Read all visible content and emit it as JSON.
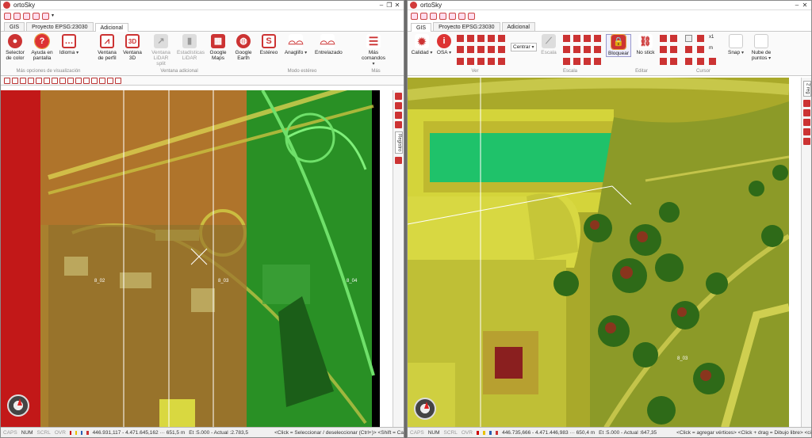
{
  "colors": {
    "accent_red": "#d23b3b",
    "ribbon_bg": "#fafafa",
    "status_bg": "#f0f0f0"
  },
  "left_window": {
    "title": "ortoSky",
    "tabs": [
      "GIS",
      "Proyecto EPSG:23030",
      "Adicional"
    ],
    "active_tab": "Adicional",
    "ribbon_buttons": [
      {
        "label": "Selector de color",
        "icon": "palette-icon",
        "enabled": true
      },
      {
        "label": "Ayuda en pantalla",
        "icon": "help-icon",
        "enabled": true
      },
      {
        "label": "Idioma",
        "icon": "speech-bubble-icon",
        "enabled": true
      },
      {
        "label": "Ventana de perfil",
        "icon": "profile-chart-icon",
        "enabled": true
      },
      {
        "label": "Ventana 3D",
        "icon": "3d-icon",
        "enabled": true
      },
      {
        "label": "Ventana LiDAR split",
        "icon": "lidar-split-icon",
        "enabled": false
      },
      {
        "label": "Estadísticas LiDAR",
        "icon": "statistics-icon",
        "enabled": false
      },
      {
        "label": "Google Maps",
        "icon": "google-maps-icon",
        "enabled": true
      },
      {
        "label": "Google Earth",
        "icon": "google-earth-icon",
        "enabled": true
      },
      {
        "label": "Estéreo",
        "icon": "stereo-icon",
        "enabled": true
      },
      {
        "label": "Anaglifo",
        "icon": "anaglyph-glasses-icon",
        "enabled": true
      },
      {
        "label": "Entrelazado",
        "icon": "interlaced-glasses-icon",
        "enabled": true
      },
      {
        "label": "Más comandos",
        "icon": "menu-lines-icon",
        "enabled": true
      }
    ],
    "groups": [
      "Más opciones de visualización",
      "Ventana adicional",
      "Modo estéreo",
      "Más"
    ],
    "map_labels": [
      "8_02",
      "8_03",
      "8_04"
    ],
    "side_tab": "Registro",
    "status": {
      "caps": "CAPS",
      "num": "NUM",
      "scrl": "SCRL",
      "ovr": "OVR",
      "coords": "446.931,117 - 4.471.645,162 ··· 651,5 m",
      "scale": "Et :5.000 - Actual :2.783,5",
      "hint": "<Click = Seleccionar / deseleccionar (Ctrl+)> <Shift = Ca"
    }
  },
  "right_window": {
    "title": "ortoSky",
    "tabs": [
      "GIS",
      "Proyecto EPSG:23030",
      "Adicional"
    ],
    "active_tab": "GIS",
    "ribbon_buttons": [
      {
        "label": "Calidad",
        "icon": "quality-sun-icon"
      },
      {
        "label": "OSA",
        "icon": "info-icon"
      },
      {
        "label": "Centrar",
        "icon": "center-icon"
      },
      {
        "label": "Escala",
        "icon": "scale-icon"
      },
      {
        "label": "Bloquear",
        "icon": "lock-icon"
      },
      {
        "label": "No stick",
        "icon": "no-stick-icon"
      },
      {
        "label": "Snap",
        "icon": "snap-icon"
      },
      {
        "label": "Nube de puntos",
        "icon": "point-cloud-icon"
      }
    ],
    "zoom_labels": [
      "x1",
      "m"
    ],
    "groups": [
      "Ver",
      "Escala",
      "Editar",
      "Cursor"
    ],
    "map_labels": [
      "8_03"
    ],
    "side_tab": "2 reg",
    "status": {
      "caps": "CAPS",
      "num": "NUM",
      "scrl": "SCRL",
      "ovr": "OVR",
      "coords": "446.735,666 - 4.471.446,983 ··· 650,4 m",
      "scale": "Et :5.000 - Actual :647,35",
      "hint": "<Click = agregar vértices> <Click + drag = Dibujo libre> <ci"
    }
  }
}
